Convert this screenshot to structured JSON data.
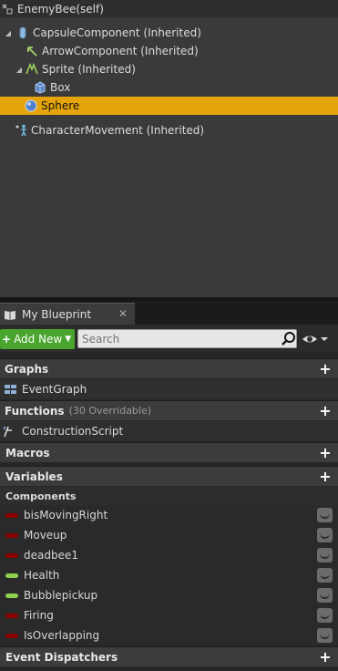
{
  "components_tree": {
    "root": {
      "label": "EnemyBee(self)"
    },
    "items": [
      {
        "label": "CapsuleComponent (Inherited)",
        "icon": "capsule-icon"
      },
      {
        "label": "ArrowComponent (Inherited)",
        "icon": "arrow-component-icon"
      },
      {
        "label": "Sprite (Inherited)",
        "icon": "sprite-icon"
      },
      {
        "label": "Box",
        "icon": "box-icon"
      },
      {
        "label": "Sphere",
        "icon": "sphere-icon",
        "selected": true
      },
      {
        "label": "CharacterMovement (Inherited)",
        "icon": "character-movement-icon"
      }
    ]
  },
  "my_blueprint": {
    "tab_label": "My Blueprint",
    "add_new_label": "Add New",
    "search_placeholder": "Search",
    "graphs": {
      "label": "Graphs",
      "items": [
        "EventGraph"
      ]
    },
    "functions": {
      "label": "Functions",
      "sub": "(30 Overridable)",
      "items": [
        "ConstructionScript"
      ]
    },
    "macros": {
      "label": "Macros"
    },
    "variables": {
      "label": "Variables",
      "components_label": "Components",
      "items": [
        {
          "label": "bisMovingRight",
          "color": "#8b0000"
        },
        {
          "label": "Moveup",
          "color": "#8b0000"
        },
        {
          "label": "deadbee1",
          "color": "#8b0000"
        },
        {
          "label": "Health",
          "color": "#8fd14f"
        },
        {
          "label": "Bubblepickup",
          "color": "#8fd14f"
        },
        {
          "label": "Firing",
          "color": "#8b0000"
        },
        {
          "label": "IsOverlapping",
          "color": "#8b0000"
        }
      ]
    },
    "event_dispatchers": {
      "label": "Event Dispatchers"
    }
  },
  "colors": {
    "selected": "#e5a50a",
    "add_new": "#4aa52e"
  }
}
